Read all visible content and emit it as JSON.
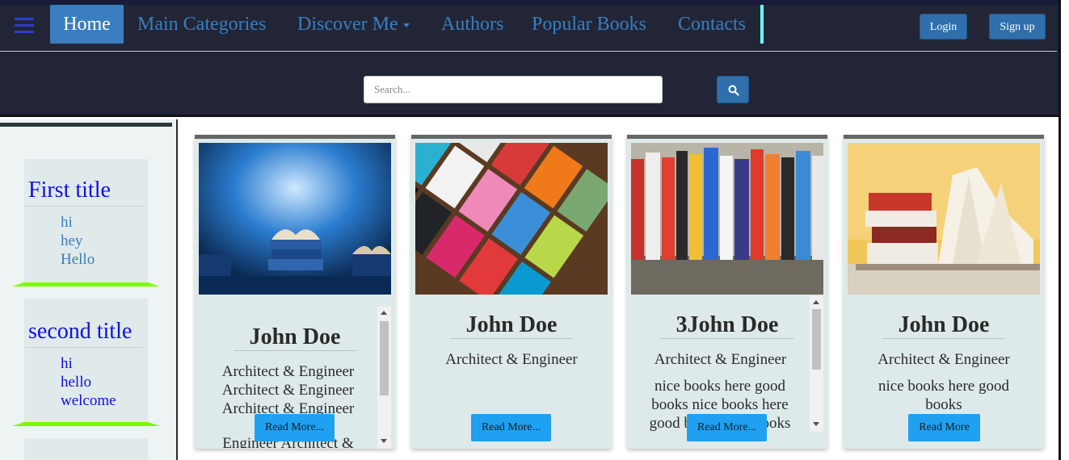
{
  "nav": {
    "home": "Home",
    "links": [
      "Main Categories",
      "Discover Me",
      "Authors",
      "Popular Books",
      "Contacts"
    ],
    "login": "Login",
    "signup": "Sign up"
  },
  "search": {
    "placeholder": "Search..."
  },
  "sidebar": {
    "blocks": [
      {
        "title": "First title",
        "items": [
          "hi",
          "hey",
          "Hello"
        ]
      },
      {
        "title": "second title",
        "items": [
          "hi",
          "hello",
          "welcome"
        ]
      }
    ]
  },
  "cards": [
    {
      "name": "John Doe",
      "role_lines": [
        "Architect & Engineer",
        "Architect & Engineer",
        "Architect & Engineer"
      ],
      "overflow_text": "Engineer Architect &",
      "button": "Read More..."
    },
    {
      "name": "John Doe",
      "role": "Architect & Engineer",
      "button": "Read More..."
    },
    {
      "name": "3John Doe",
      "role": "Architect & Engineer",
      "desc": "nice books here good books nice books here good books nice books",
      "button": "Read More..."
    },
    {
      "name": "John Doe",
      "role": "Architect & Engineer",
      "desc": "nice books here good books",
      "button": "Read More"
    }
  ],
  "colors": {
    "header_bg": "#222536",
    "nav_accent": "#3a7ebf",
    "button_blue": "#1fa0f0",
    "sidebar_title": "#1010e0",
    "separator_green": "#7cfc00"
  },
  "icons": [
    "hamburger-icon",
    "caret-down-icon",
    "search-icon"
  ]
}
